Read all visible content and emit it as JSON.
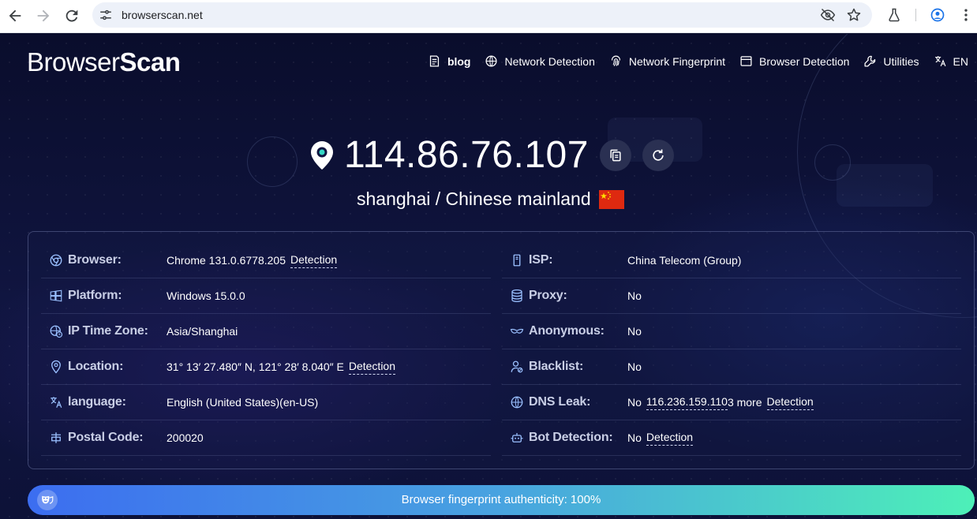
{
  "browser": {
    "url": "browserscan.net"
  },
  "header": {
    "logo_part1": "Browser",
    "logo_part2": "Scan",
    "nav": [
      {
        "label": "blog",
        "icon": "blog-icon"
      },
      {
        "label": "Network Detection",
        "icon": "globe-icon"
      },
      {
        "label": "Network Fingerprint",
        "icon": "fingerprint-icon"
      },
      {
        "label": "Browser Detection",
        "icon": "browser-window-icon"
      },
      {
        "label": "Utilities",
        "icon": "wrench-icon"
      },
      {
        "label": "EN",
        "icon": "translate-icon"
      }
    ]
  },
  "hero": {
    "ip": "114.86.76.107",
    "location": "shanghai / Chinese mainland",
    "flag": "china-flag"
  },
  "info": {
    "left": [
      {
        "label": "Browser:",
        "value": "Chrome 131.0.6778.205",
        "link": "Detection",
        "icon": "chrome-icon"
      },
      {
        "label": "Platform:",
        "value": "Windows 15.0.0",
        "icon": "windows-icon"
      },
      {
        "label": "IP Time Zone:",
        "value": "Asia/Shanghai",
        "icon": "timezone-icon"
      },
      {
        "label": "Location:",
        "value": "31° 13′ 27.480″ N, 121° 28′ 8.040″ E",
        "link": "Detection",
        "icon": "location-pin-icon"
      },
      {
        "label": "language:",
        "value": "English (United States)(en-US)",
        "icon": "translate-icon"
      },
      {
        "label": "Postal Code:",
        "value": "200020",
        "icon": "postal-icon"
      }
    ],
    "right": [
      {
        "label": "ISP:",
        "value": "China Telecom (Group)",
        "icon": "server-icon"
      },
      {
        "label": "Proxy:",
        "value": "No",
        "icon": "database-icon"
      },
      {
        "label": "Anonymous:",
        "value": "No",
        "icon": "mask-icon"
      },
      {
        "label": "Blacklist:",
        "value": "No",
        "icon": "user-block-icon"
      },
      {
        "label": "DNS Leak:",
        "value": "No",
        "dns_ip": "116.236.159.110",
        "dns_more": "3 more",
        "link": "Detection",
        "icon": "dns-icon"
      },
      {
        "label": "Bot Detection:",
        "value": "No",
        "link": "Detection",
        "icon": "robot-icon"
      }
    ]
  },
  "authenticity": {
    "text": "Browser fingerprint authenticity: 100%",
    "percent": 100
  }
}
